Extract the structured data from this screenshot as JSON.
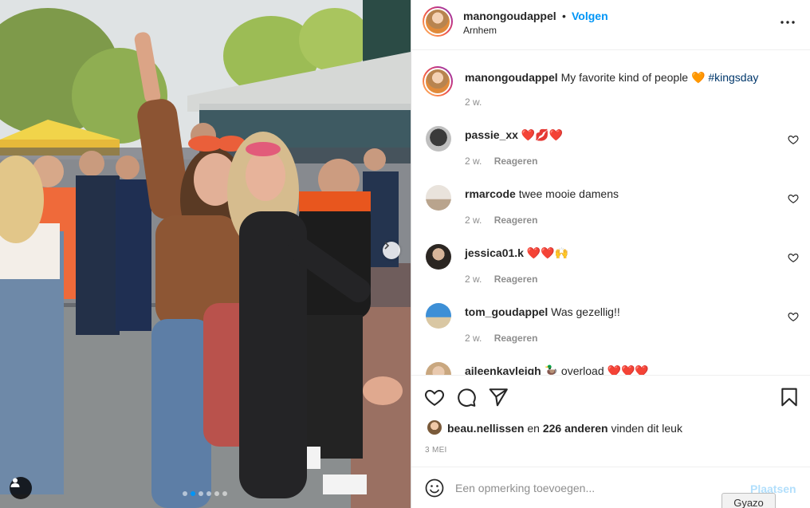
{
  "header": {
    "username": "manongoudappel",
    "separator": "•",
    "follow_label": "Volgen",
    "location": "Arnhem",
    "more_icon": "more-horizontal-icon"
  },
  "caption": {
    "username": "manongoudappel",
    "text": "My favorite kind of people 🧡",
    "hashtag": "#kingsday",
    "time": "2 w."
  },
  "comments": [
    {
      "username": "passie_xx",
      "text": "❤️💋❤️",
      "time": "2 w.",
      "reply_label": "Reageren"
    },
    {
      "username": "rmarcode",
      "text": "twee mooie damens",
      "time": "2 w.",
      "reply_label": "Reageren"
    },
    {
      "username": "jessica01.k",
      "text": "❤️❤️🙌",
      "time": "2 w.",
      "reply_label": "Reageren"
    },
    {
      "username": "tom_goudappel",
      "text": "Was gezellig!!",
      "time": "2 w.",
      "reply_label": "Reageren"
    },
    {
      "username": "aileenkayleigh",
      "text": "🦆 overload ❤️❤️❤️"
    }
  ],
  "likes": {
    "first_user": "beau.nellissen",
    "connector": "en",
    "others": "226 anderen",
    "suffix": "vinden dit leuk"
  },
  "date": "3 MEI",
  "add_comment": {
    "placeholder": "Een opmerking toevoegen...",
    "post_label": "Plaatsen"
  },
  "overlay": {
    "gyazo_label": "Gyazo"
  },
  "carousel": {
    "total": 6,
    "active_index": 1
  },
  "colors": {
    "accent": "#0095f6",
    "hashtag": "#00376b",
    "secondary_text": "#8e8e8e",
    "post_disabled": "#b2dffc"
  }
}
